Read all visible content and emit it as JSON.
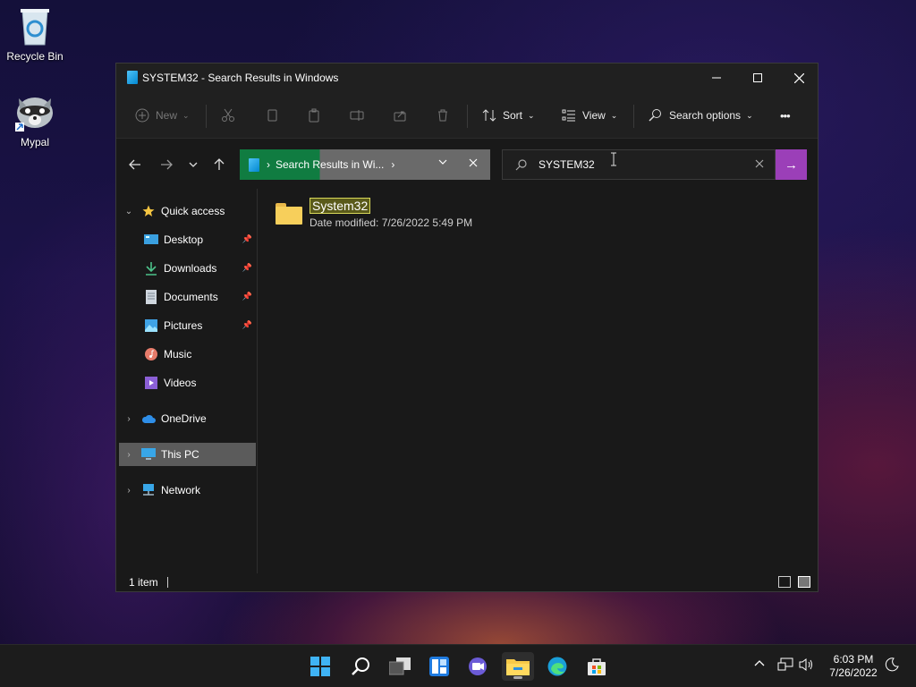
{
  "desktop": {
    "icons": [
      {
        "label": "Recycle Bin"
      },
      {
        "label": "Mypal"
      }
    ]
  },
  "window": {
    "title": "SYSTEM32 - Search Results in Windows",
    "toolbar": {
      "new_label": "New",
      "sort_label": "Sort",
      "view_label": "View",
      "search_options_label": "Search options",
      "more_label": "•••"
    },
    "address": {
      "path": "Search Results in Wi...",
      "chevron": "›"
    },
    "search": {
      "value": "SYSTEM32",
      "go": "→"
    },
    "sidebar": {
      "items": [
        {
          "label": "Quick access"
        },
        {
          "label": "Desktop"
        },
        {
          "label": "Downloads"
        },
        {
          "label": "Documents"
        },
        {
          "label": "Pictures"
        },
        {
          "label": "Music"
        },
        {
          "label": "Videos"
        },
        {
          "label": "OneDrive"
        },
        {
          "label": "This PC"
        },
        {
          "label": "Network"
        }
      ]
    },
    "results": [
      {
        "name": "System32",
        "meta": "Date modified: 7/26/2022 5:49 PM"
      }
    ],
    "status": {
      "count": "1 item"
    }
  },
  "taskbar": {
    "time": "6:03 PM",
    "date": "7/26/2022"
  },
  "colors": {
    "address_progress": "#107c41",
    "search_go": "#9b3fb8",
    "selected_nav": "#5b5b5b"
  }
}
